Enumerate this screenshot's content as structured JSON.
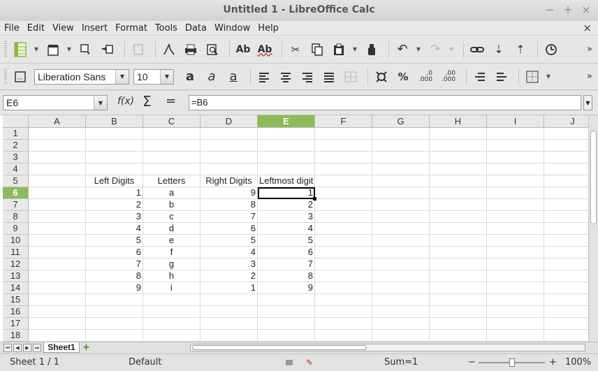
{
  "window": {
    "title": "Untitled 1 - LibreOffice Calc",
    "controls": [
      "−",
      "+",
      "×"
    ]
  },
  "menu": {
    "items": [
      "File",
      "Edit",
      "View",
      "Insert",
      "Format",
      "Tools",
      "Data",
      "Window",
      "Help"
    ],
    "close_doc": "×"
  },
  "toolbar_standard": {
    "icons": [
      "new-spreadsheet-icon",
      "templates-icon",
      "open-icon",
      "save-icon",
      "export-pdf-icon",
      "edit-file-icon",
      "print-icon",
      "print-preview-icon",
      "spelling-icon",
      "autospellcheck-icon",
      "cut-icon",
      "copy-icon",
      "paste-icon",
      "clone-formatting-icon",
      "undo-icon",
      "redo-icon",
      "hyperlink-icon",
      "sort-descending-icon",
      "sort-ascending-icon",
      "chart-icon"
    ],
    "overflow": "»"
  },
  "toolbar_formatting": {
    "font_name": "Liberation Sans",
    "font_size": "10",
    "bold": "a",
    "italic": "a",
    "underline": "a",
    "percent": "%",
    "add_decimal": ",0\n.000",
    "delete_decimal": ",00\n.000",
    "overflow": "»"
  },
  "formula_bar": {
    "name_box": "E6",
    "function_wizard": "f(x)",
    "sum": "Σ",
    "equals": "=",
    "input": "=B6"
  },
  "sheet": {
    "columns": [
      "A",
      "B",
      "C",
      "D",
      "E",
      "F",
      "G",
      "H",
      "I",
      "J"
    ],
    "active_column": "E",
    "rows": [
      "1",
      "2",
      "3",
      "4",
      "5",
      "6",
      "7",
      "8",
      "9",
      "10",
      "11",
      "12",
      "13",
      "14",
      "15",
      "16",
      "17",
      "18"
    ],
    "active_row": "6",
    "headers": {
      "B5": "Left Digits",
      "C5": "Letters",
      "D5": "Right Digits",
      "E5": "Leftmost digit"
    },
    "data": [
      {
        "left": "1",
        "letter": "a",
        "right": "9",
        "leftmost": "1"
      },
      {
        "left": "2",
        "letter": "b",
        "right": "8",
        "leftmost": "2"
      },
      {
        "left": "3",
        "letter": "c",
        "right": "7",
        "leftmost": "3"
      },
      {
        "left": "4",
        "letter": "d",
        "right": "6",
        "leftmost": "4"
      },
      {
        "left": "5",
        "letter": "e",
        "right": "5",
        "leftmost": "5"
      },
      {
        "left": "6",
        "letter": "f",
        "right": "4",
        "leftmost": "6"
      },
      {
        "left": "7",
        "letter": "g",
        "right": "3",
        "leftmost": "7"
      },
      {
        "left": "8",
        "letter": "h",
        "right": "2",
        "leftmost": "8"
      },
      {
        "left": "9",
        "letter": "i",
        "right": "1",
        "leftmost": "9"
      }
    ],
    "selected_cell": "E6"
  },
  "tabs": {
    "nav": [
      "⏮",
      "◀",
      "▶",
      "⏭"
    ],
    "sheet_name": "Sheet1",
    "add": "+"
  },
  "status": {
    "sheet": "Sheet 1 / 1",
    "page_style": "Default",
    "sum": "Sum=1",
    "zoom_minus": "−",
    "zoom_plus": "+",
    "zoom": "100%"
  }
}
